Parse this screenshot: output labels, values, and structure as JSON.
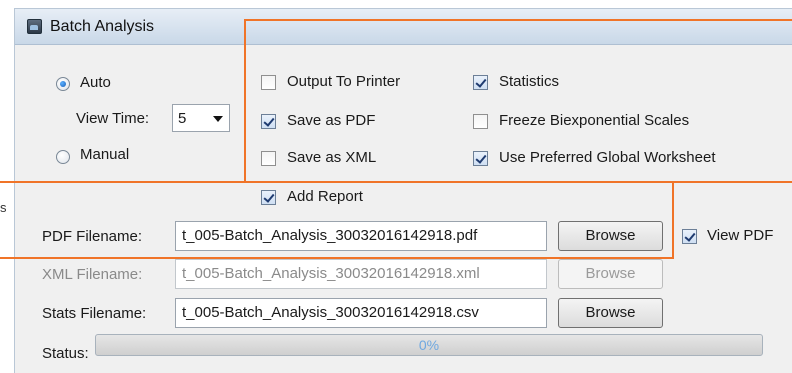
{
  "window": {
    "title": "Batch Analysis"
  },
  "mode": {
    "auto_label": "Auto",
    "auto_selected": true,
    "view_time_label": "View Time:",
    "view_time_value": "5",
    "manual_label": "Manual",
    "manual_selected": false
  },
  "options": {
    "output_to_printer": {
      "label": "Output To Printer",
      "checked": false
    },
    "save_as_pdf": {
      "label": "Save as PDF",
      "checked": true
    },
    "save_as_xml": {
      "label": "Save as XML",
      "checked": false
    },
    "add_report": {
      "label": "Add Report",
      "checked": true
    },
    "statistics": {
      "label": "Statistics",
      "checked": true
    },
    "freeze_biexponential": {
      "label": "Freeze Biexponential Scales",
      "checked": false
    },
    "use_preferred_worksheet": {
      "label": "Use Preferred Global Worksheet",
      "checked": true
    }
  },
  "files": {
    "pdf": {
      "label": "PDF Filename:",
      "value": "t_005-Batch_Analysis_30032016142918.pdf",
      "browse": "Browse",
      "enabled": true
    },
    "xml": {
      "label": "XML Filename:",
      "value": "t_005-Batch_Analysis_30032016142918.xml",
      "browse": "Browse",
      "enabled": false
    },
    "stats": {
      "label": "Stats Filename:",
      "value": "t_005-Batch_Analysis_30032016142918.csv",
      "browse": "Browse",
      "enabled": true
    },
    "view_pdf": {
      "label": "View PDF",
      "checked": true
    }
  },
  "status": {
    "label": "Status:",
    "progress_text": "0%",
    "progress_fraction": 0
  },
  "highlight_color": "#f07428",
  "stray_text": "s"
}
